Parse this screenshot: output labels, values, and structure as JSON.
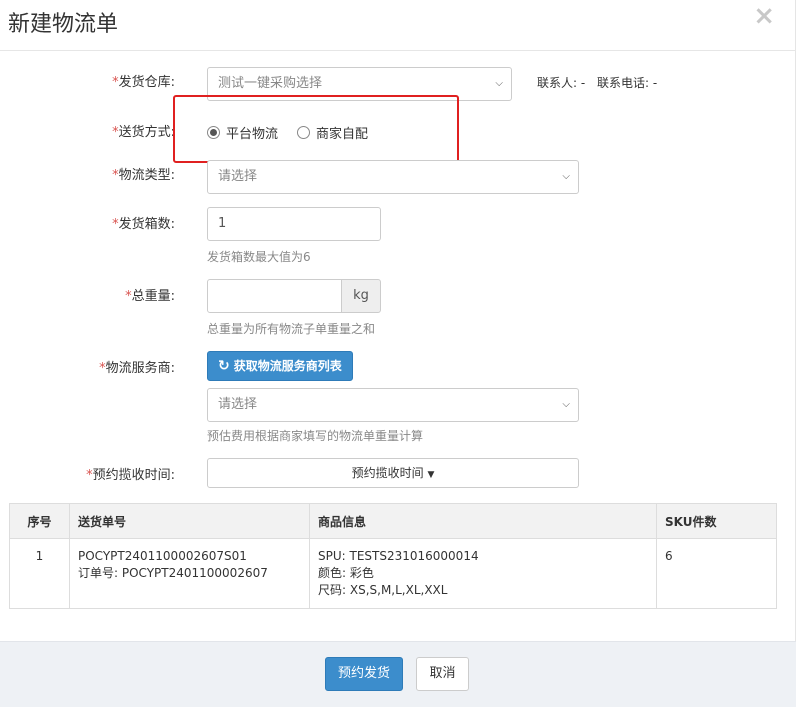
{
  "modal": {
    "title": "新建物流单",
    "close_glyph": "×"
  },
  "form": {
    "warehouse": {
      "label": "发货仓库:",
      "value": "测试一键采购选择",
      "contact_person": "联系人: -",
      "contact_phone": "联系电话: -"
    },
    "delivery_method": {
      "label": "送货方式:",
      "options": [
        "平台物流",
        "商家自配"
      ],
      "selected": "平台物流"
    },
    "logistics_type": {
      "label": "物流类型:",
      "placeholder": "请选择"
    },
    "box_count": {
      "label": "发货箱数:",
      "value": "1",
      "help": "发货箱数最大值为6"
    },
    "total_weight": {
      "label": "总重量:",
      "value": "",
      "unit": "kg",
      "help": "总重量为所有物流子单重量之和"
    },
    "service_provider": {
      "label": "物流服务商:",
      "fetch_button": "获取物流服务商列表",
      "placeholder": "请选择",
      "help": "预估费用根据商家填写的物流单重量计算"
    },
    "pickup_time": {
      "label": "预约揽收时间:",
      "button": "预约揽收时间"
    },
    "required_mark": "*"
  },
  "table": {
    "headers": [
      "序号",
      "送货单号",
      "商品信息",
      "SKU件数"
    ],
    "rows": [
      {
        "index": "1",
        "delivery_no": "POCYPT2401100002607S01",
        "order_no": "订单号: POCYPT2401100002607",
        "spu": "SPU: TESTS231016000014",
        "color": "颜色: 彩色",
        "size": "尺码: XS,S,M,L,XL,XXL",
        "sku_qty": "6"
      }
    ]
  },
  "footer": {
    "confirm": "预约发货",
    "cancel": "取消"
  },
  "colors": {
    "primary": "#3c8dcc",
    "required": "#d9534f",
    "highlight": "#e02020"
  }
}
